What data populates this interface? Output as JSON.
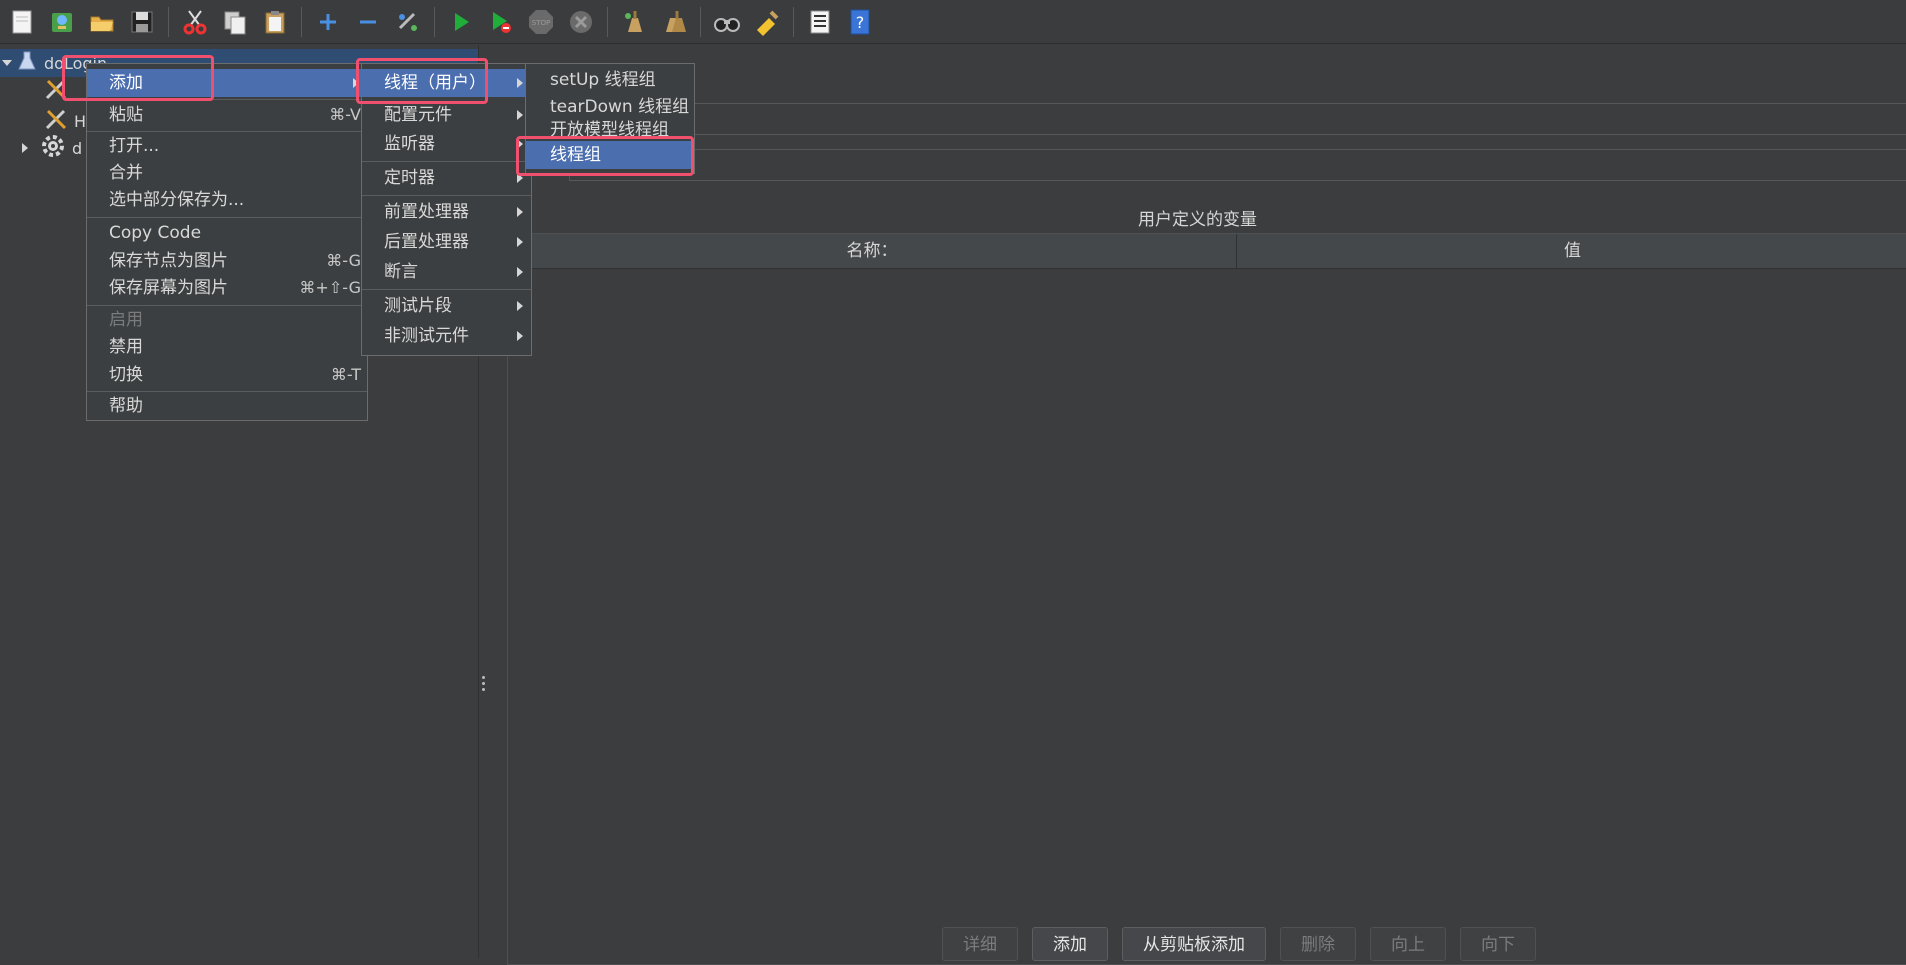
{
  "toolbar": {
    "icons": [
      "new-icon",
      "templates-icon",
      "open-icon",
      "save-icon",
      "cut-icon",
      "copy-icon",
      "paste-icon",
      "expand-icon",
      "collapse-icon",
      "toggle-icon",
      "start-icon",
      "start-no-pause-icon",
      "stop-icon",
      "shutdown-icon",
      "clear-icon",
      "clear-all-icon",
      "search-icon",
      "reset-search-icon",
      "function-helper-icon",
      "help-icon"
    ],
    "stop_label": "STOP"
  },
  "tree": {
    "root_label": "doLogin",
    "item2_label": "H",
    "item3_label": "d"
  },
  "context_menu": {
    "items": [
      {
        "label": "添加",
        "shortcut": "",
        "submenu": true,
        "selected": true
      },
      {
        "label": "粘贴",
        "shortcut": "⌘-V"
      },
      {
        "label": "打开..."
      },
      {
        "label": "合并"
      },
      {
        "label": "选中部分保存为..."
      },
      {
        "label": "Copy Code"
      },
      {
        "label": "保存节点为图片",
        "shortcut": "⌘-G"
      },
      {
        "label": "保存屏幕为图片",
        "shortcut": "⌘+⇧-G"
      },
      {
        "label": "启用",
        "disabled": true
      },
      {
        "label": "禁用"
      },
      {
        "label": "切换",
        "shortcut": "⌘-T"
      },
      {
        "label": "帮助"
      }
    ]
  },
  "add_submenu": {
    "items": [
      {
        "label": "线程（用户）",
        "selected": true
      },
      {
        "label": "配置元件"
      },
      {
        "label": "监听器"
      },
      {
        "label": "定时器"
      },
      {
        "label": "前置处理器"
      },
      {
        "label": "后置处理器"
      },
      {
        "label": "断言"
      },
      {
        "label": "测试片段"
      },
      {
        "label": "非测试元件"
      }
    ]
  },
  "thread_submenu": {
    "items": [
      {
        "label": "setUp 线程组"
      },
      {
        "label": "tearDown 线程组"
      },
      {
        "label": "开放模型线程组"
      },
      {
        "label": "线程组",
        "selected": true
      }
    ]
  },
  "right_panel": {
    "vars_title": "用户定义的变量",
    "col_name": "名称：",
    "col_value": "值",
    "buttons": {
      "detail": "详细",
      "add": "添加",
      "add_clipboard": "从剪贴板添加",
      "delete": "删除",
      "up": "向上",
      "down": "向下"
    }
  },
  "colors": {
    "menu_selected": "#4b6eaf",
    "highlight_box": "#f0506e",
    "background": "#3b3d3f"
  }
}
